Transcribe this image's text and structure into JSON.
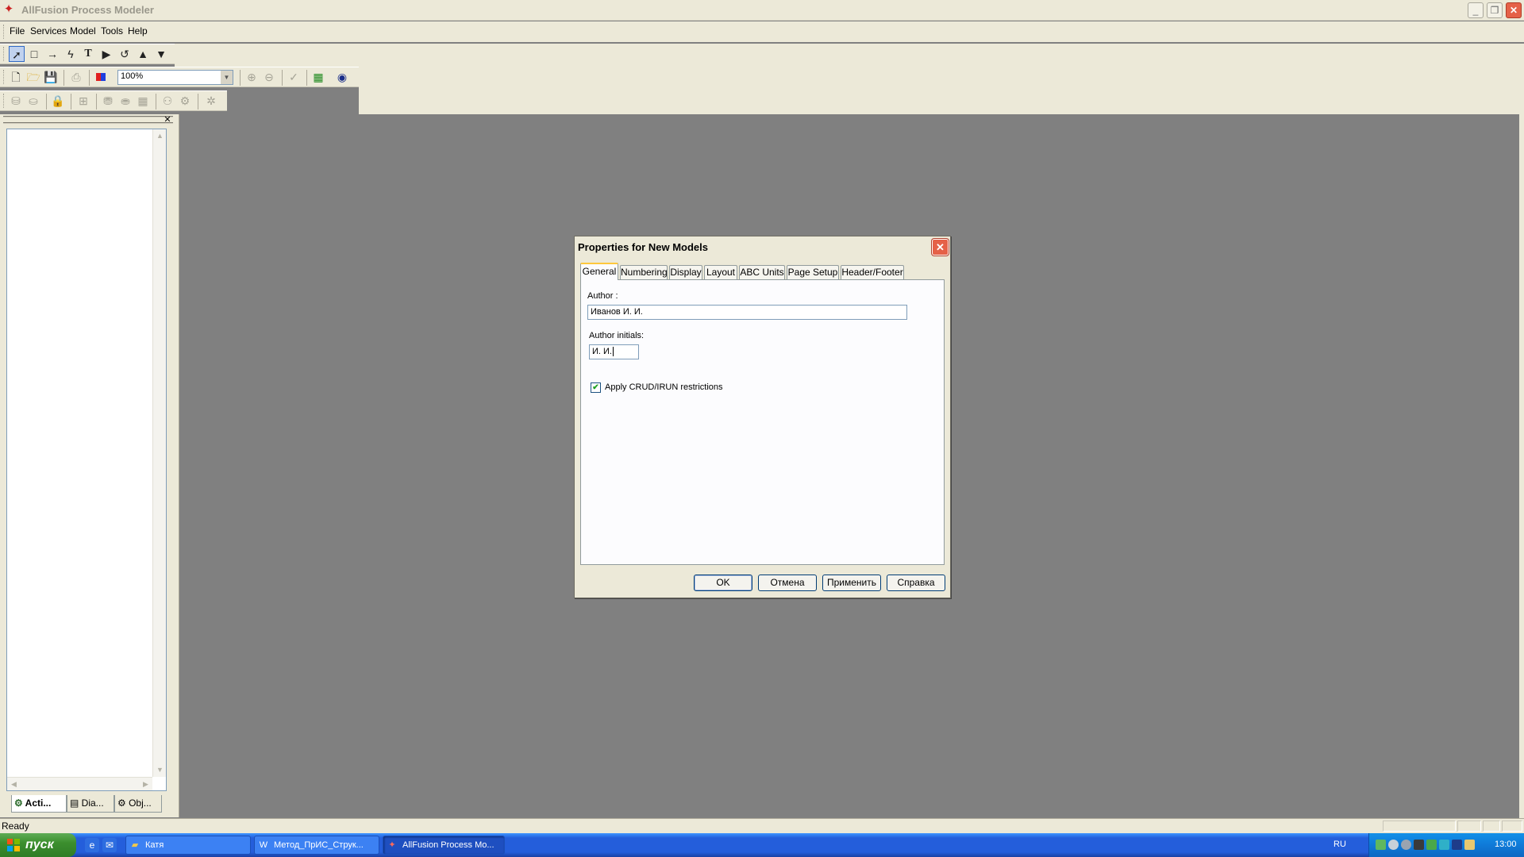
{
  "window": {
    "title": "AllFusion Process Modeler"
  },
  "menu": [
    "File",
    "Services",
    "Model",
    "Tools",
    "Help"
  ],
  "toolbar": {
    "zoom": "100%"
  },
  "dock": {
    "tabs": [
      "Acti...",
      "Dia...",
      "Obj..."
    ]
  },
  "dialog": {
    "title": "Properties for New Models",
    "tabs": [
      "General",
      "Numbering",
      "Display",
      "Layout",
      "ABC Units",
      "Page Setup",
      "Header/Footer"
    ],
    "author_label": "Author :",
    "author_value": "Иванов И. И.",
    "initials_label": "Author initials:",
    "initials_value": "И. И.",
    "crud_label": "Apply CRUD/IRUN restrictions",
    "crud_checked": true,
    "buttons": [
      "OK",
      "Отмена",
      "Применить",
      "Справка"
    ]
  },
  "status": {
    "text": "Ready"
  },
  "taskbar": {
    "start": "пуск",
    "tasks": [
      "Катя",
      "Метод_ПрИС_Струк...",
      "AllFusion Process Mo..."
    ],
    "lang": "RU",
    "clock": "13:00"
  },
  "colors": {
    "accent_tab": "#ffc83c",
    "close_red": "#e56148",
    "taskbar_blue": "#245edb",
    "workspace": "#808080"
  }
}
